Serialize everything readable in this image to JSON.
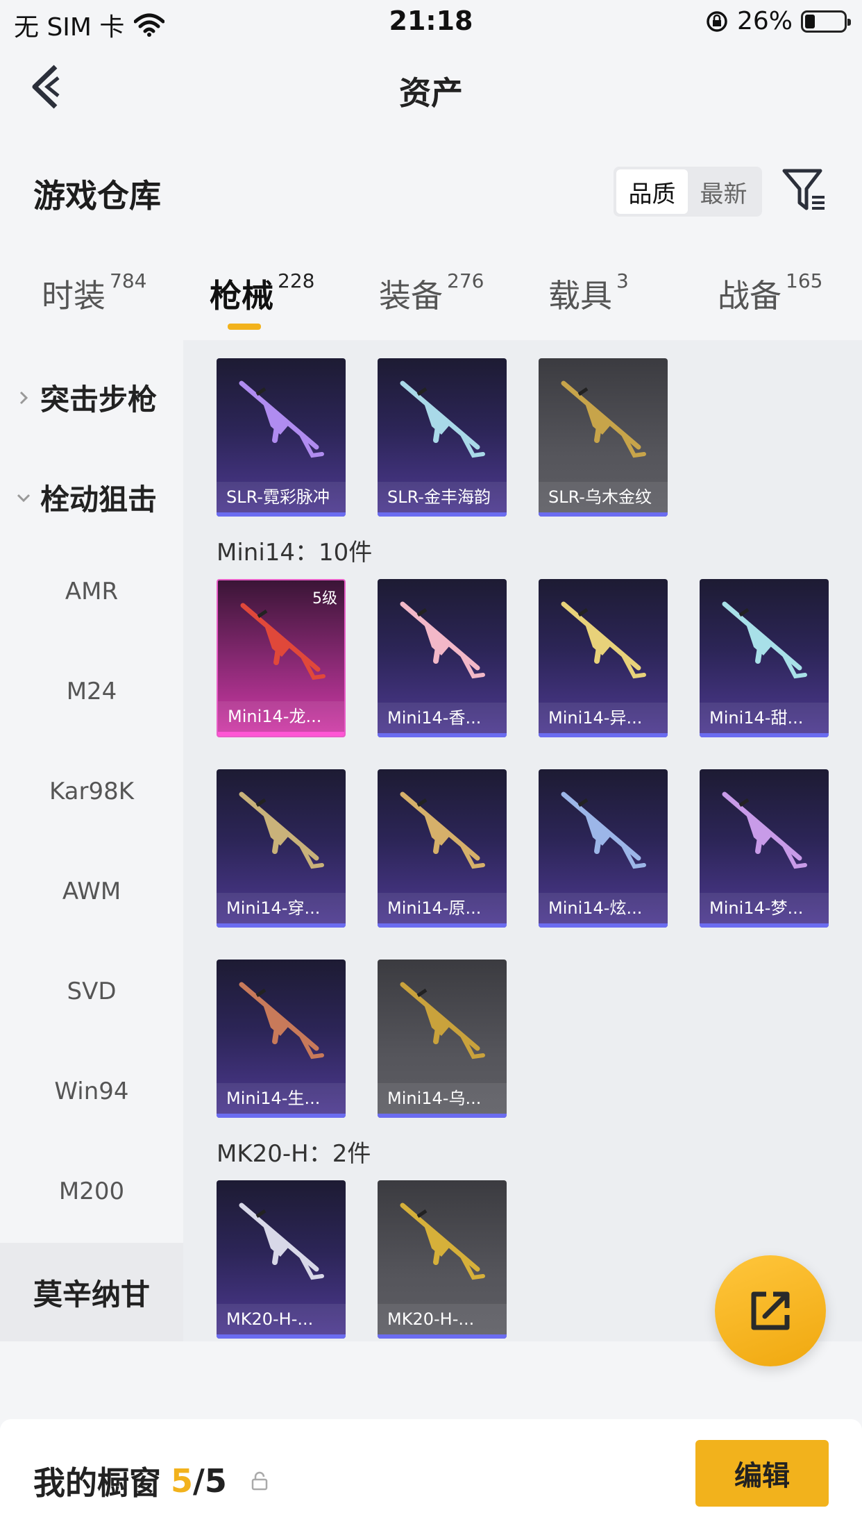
{
  "status_bar": {
    "carrier": "无 SIM 卡",
    "time": "21:18",
    "battery": "26%",
    "battery_level": 0.26
  },
  "nav": {
    "title": "资产"
  },
  "header": {
    "section_title": "游戏仓库",
    "sort_options": [
      "品质",
      "最新"
    ],
    "sort_selected": "品质"
  },
  "tabs": [
    {
      "label": "时装",
      "count": "784"
    },
    {
      "label": "枪械",
      "count": "228"
    },
    {
      "label": "装备",
      "count": "276"
    },
    {
      "label": "载具",
      "count": "3"
    },
    {
      "label": "战备",
      "count": "165"
    }
  ],
  "tabs_selected": "枪械",
  "sidebar": {
    "groups": [
      {
        "label": "突击步枪",
        "expanded": false
      },
      {
        "label": "栓动狙击",
        "expanded": true
      }
    ],
    "items": [
      "AMR",
      "M24",
      "Kar98K",
      "AWM",
      "SVD",
      "Win94",
      "M200"
    ],
    "bottom_item": "莫辛纳甘"
  },
  "content": {
    "slr_items": [
      {
        "name": "SLR-霓彩脉冲",
        "rarity": "purple",
        "color": "#b08cf0"
      },
      {
        "name": "SLR-金丰海韵",
        "rarity": "purple",
        "color": "#a9d9e8"
      },
      {
        "name": "SLR-乌木金纹",
        "rarity": "grey",
        "color": "#c7a44a"
      }
    ],
    "mini14_heading": "Mini14：10件",
    "mini14_items": [
      {
        "name": "Mini14-龙...",
        "rarity": "pink",
        "level": "5级",
        "color": "#e0483a"
      },
      {
        "name": "Mini14-香...",
        "rarity": "purple",
        "color": "#f2b8c8"
      },
      {
        "name": "Mini14-异...",
        "rarity": "purple",
        "color": "#e8d27a"
      },
      {
        "name": "Mini14-甜...",
        "rarity": "purple",
        "color": "#a8e0e8"
      },
      {
        "name": "Mini14-穿...",
        "rarity": "purple",
        "color": "#c9b27a"
      },
      {
        "name": "Mini14-原...",
        "rarity": "purple",
        "color": "#d6b06a"
      },
      {
        "name": "Mini14-炫...",
        "rarity": "purple",
        "color": "#9cb6e8"
      },
      {
        "name": "Mini14-梦...",
        "rarity": "purple",
        "color": "#c89be8"
      },
      {
        "name": "Mini14-生...",
        "rarity": "purple",
        "color": "#c87a5a"
      },
      {
        "name": "Mini14-乌...",
        "rarity": "grey",
        "color": "#c9a23c"
      }
    ],
    "mk20_heading": "MK20-H：2件",
    "mk20_items": [
      {
        "name": "MK20-H-...",
        "rarity": "purple",
        "color": "#d8d8e8"
      },
      {
        "name": "MK20-H-...",
        "rarity": "grey",
        "color": "#d6b03a"
      }
    ]
  },
  "fab": {
    "icon": "share-icon"
  },
  "bottom_bar": {
    "label": "我的橱窗",
    "used": "5",
    "separator": "/",
    "total": "5",
    "lock_icon": "lock-icon",
    "edit_label": "编辑"
  },
  "colors": {
    "accent": "#f2b21c",
    "purple_bar": "#6b6cf0",
    "pink_bar": "#ff56d5"
  }
}
